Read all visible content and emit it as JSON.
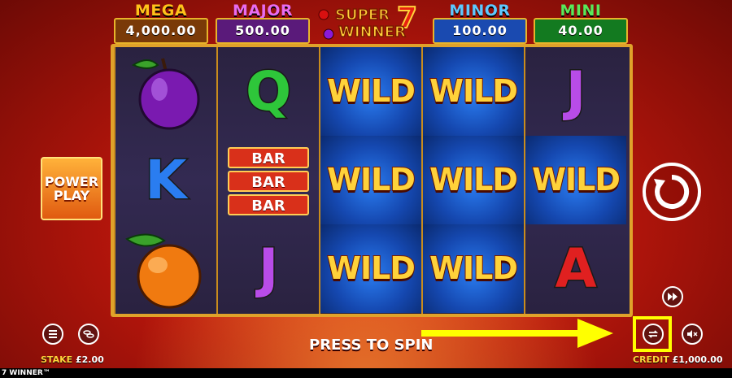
{
  "jackpots": [
    {
      "name": "MEGA",
      "value": "4,000.00",
      "title_color": "#ffc21a",
      "plate_color": "#7a3a08"
    },
    {
      "name": "MAJOR",
      "value": "500.00",
      "title_color": "#e86cf0",
      "plate_color": "#5a1a7a"
    },
    {
      "name": "MINOR",
      "value": "100.00",
      "title_color": "#5ec8ff",
      "plate_color": "#1a4ab0"
    },
    {
      "name": "MINI",
      "value": "40.00",
      "title_color": "#5ae85a",
      "plate_color": "#137a20"
    }
  ],
  "logo": {
    "line1": "SUPER",
    "line2": "WINNER",
    "badge": "7"
  },
  "reels": [
    [
      {
        "type": "fruit",
        "symbol": "plum"
      },
      {
        "type": "letter",
        "symbol": "K",
        "color": "#2a7df0"
      },
      {
        "type": "fruit",
        "symbol": "orange"
      }
    ],
    [
      {
        "type": "letter",
        "symbol": "Q",
        "color": "#2ec63a"
      },
      {
        "type": "bar",
        "labels": [
          "BAR",
          "BAR",
          "BAR"
        ]
      },
      {
        "type": "letter",
        "symbol": "J",
        "color": "#b84ce8"
      }
    ],
    [
      {
        "type": "wild",
        "label": "WILD"
      },
      {
        "type": "wild",
        "label": "WILD"
      },
      {
        "type": "wild",
        "label": "WILD"
      }
    ],
    [
      {
        "type": "wild",
        "label": "WILD"
      },
      {
        "type": "wild",
        "label": "WILD"
      },
      {
        "type": "wild",
        "label": "WILD"
      }
    ],
    [
      {
        "type": "letter",
        "symbol": "J",
        "color": "#b84ce8"
      },
      {
        "type": "wild",
        "label": "WILD"
      },
      {
        "type": "letter",
        "symbol": "A",
        "color": "#e02020"
      }
    ]
  ],
  "power_play": {
    "line1": "POWER",
    "line2": "PLAY"
  },
  "controls": {
    "press_to_spin": "PRESS TO SPIN",
    "stake_label": "STAKE",
    "stake_value": "£2.00",
    "credit_label": "CREDIT",
    "credit_value": "£1,000.00"
  },
  "footer": {
    "game_title": "7 WINNER™"
  },
  "icons": {
    "menu": "menu-icon",
    "coins": "coins-icon",
    "spin": "spin-icon",
    "turbo": "fast-forward-icon",
    "autoplay": "autoplay-icon",
    "mute": "mute-icon"
  },
  "highlight_color": "#ffff00"
}
